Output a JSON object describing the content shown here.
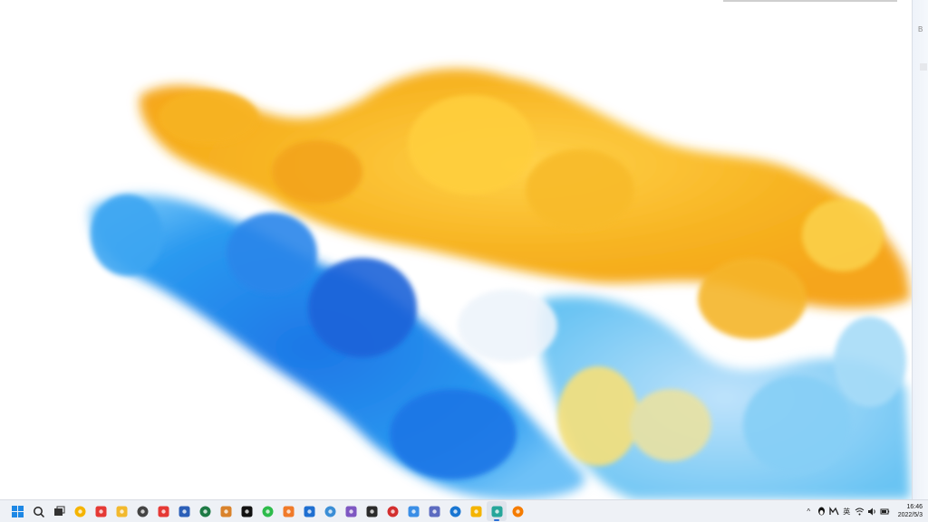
{
  "taskbar": {
    "apps": [
      {
        "name": "start",
        "color": "#1e88e5"
      },
      {
        "name": "search",
        "color": "#222222"
      },
      {
        "name": "task-view",
        "color": "#333333"
      },
      {
        "name": "app-yellow",
        "color": "#f5b400"
      },
      {
        "name": "chrome",
        "color": "#e53935"
      },
      {
        "name": "file-explorer",
        "color": "#f2b92d"
      },
      {
        "name": "app-m",
        "color": "#444444"
      },
      {
        "name": "app-red",
        "color": "#e53935"
      },
      {
        "name": "word",
        "color": "#2b5fb8"
      },
      {
        "name": "excel",
        "color": "#1e7a45"
      },
      {
        "name": "app-orange-dark",
        "color": "#d9822b"
      },
      {
        "name": "qq",
        "color": "#111111"
      },
      {
        "name": "wechat",
        "color": "#2dbb4b"
      },
      {
        "name": "app-orange",
        "color": "#f07a2a"
      },
      {
        "name": "app-blue-arrow",
        "color": "#1f6fd1"
      },
      {
        "name": "app-network",
        "color": "#3b8ed6"
      },
      {
        "name": "app-purple",
        "color": "#7e57c2"
      },
      {
        "name": "app-dark-yellow",
        "color": "#2b2b2b"
      },
      {
        "name": "netease-music",
        "color": "#d32f2f"
      },
      {
        "name": "app-cloud",
        "color": "#3a8ee6"
      },
      {
        "name": "app-circle",
        "color": "#5c6bc0"
      },
      {
        "name": "app-arrow",
        "color": "#1976d2"
      },
      {
        "name": "app-puzzle",
        "color": "#f4b400"
      },
      {
        "name": "app-cyan",
        "color": "#26a69a"
      },
      {
        "name": "app-play",
        "color": "#f57c00"
      }
    ],
    "active_index": 23,
    "tray": {
      "overflow_glyph": "^",
      "input_glyph": "英",
      "time": "16:46",
      "date": "2022/5/3"
    }
  },
  "side_panel": {
    "glyph": "B"
  }
}
